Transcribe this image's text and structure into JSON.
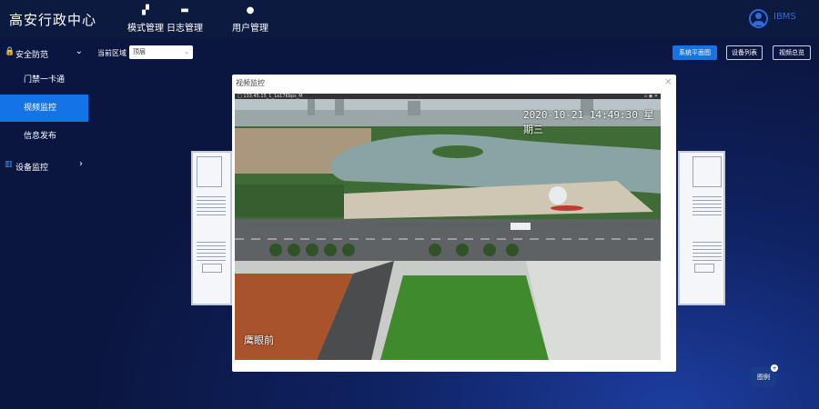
{
  "app": {
    "title": "高安行政中心"
  },
  "topnav": [
    {
      "label": "模式管理",
      "icon": "mode-icon"
    },
    {
      "label": "日志管理",
      "icon": "log-icon"
    },
    {
      "label": "用户管理",
      "icon": "user-manage-icon"
    }
  ],
  "user": {
    "name": "IBMS"
  },
  "sidebar": {
    "groups": [
      {
        "label": "安全防范",
        "icon": "lock-icon",
        "expanded": true
      },
      {
        "label": "设备监控",
        "icon": "chart-icon",
        "expanded": false
      }
    ],
    "items": [
      {
        "label": "门禁一卡通"
      },
      {
        "label": "视频监控",
        "active": true
      },
      {
        "label": "信息发布"
      }
    ]
  },
  "toolbar": {
    "region_label": "当前区域",
    "region_value": "顶层",
    "buttons": [
      {
        "label": "系统平面图",
        "primary": true
      },
      {
        "label": "设备列表"
      },
      {
        "label": "视频总览"
      }
    ]
  },
  "modal": {
    "title": "视频监控",
    "video_bar": "□ 133.45.15_1_1a17Kbps_M",
    "osd_time": "2020-10-21 14:49:30 星期三",
    "osd_location": "鹰眼前"
  },
  "legend": {
    "label": "图例"
  },
  "colors": {
    "accent": "#1473e6",
    "header_bg": "#0b1a3e",
    "sidebar_bg": "#0a1640"
  }
}
